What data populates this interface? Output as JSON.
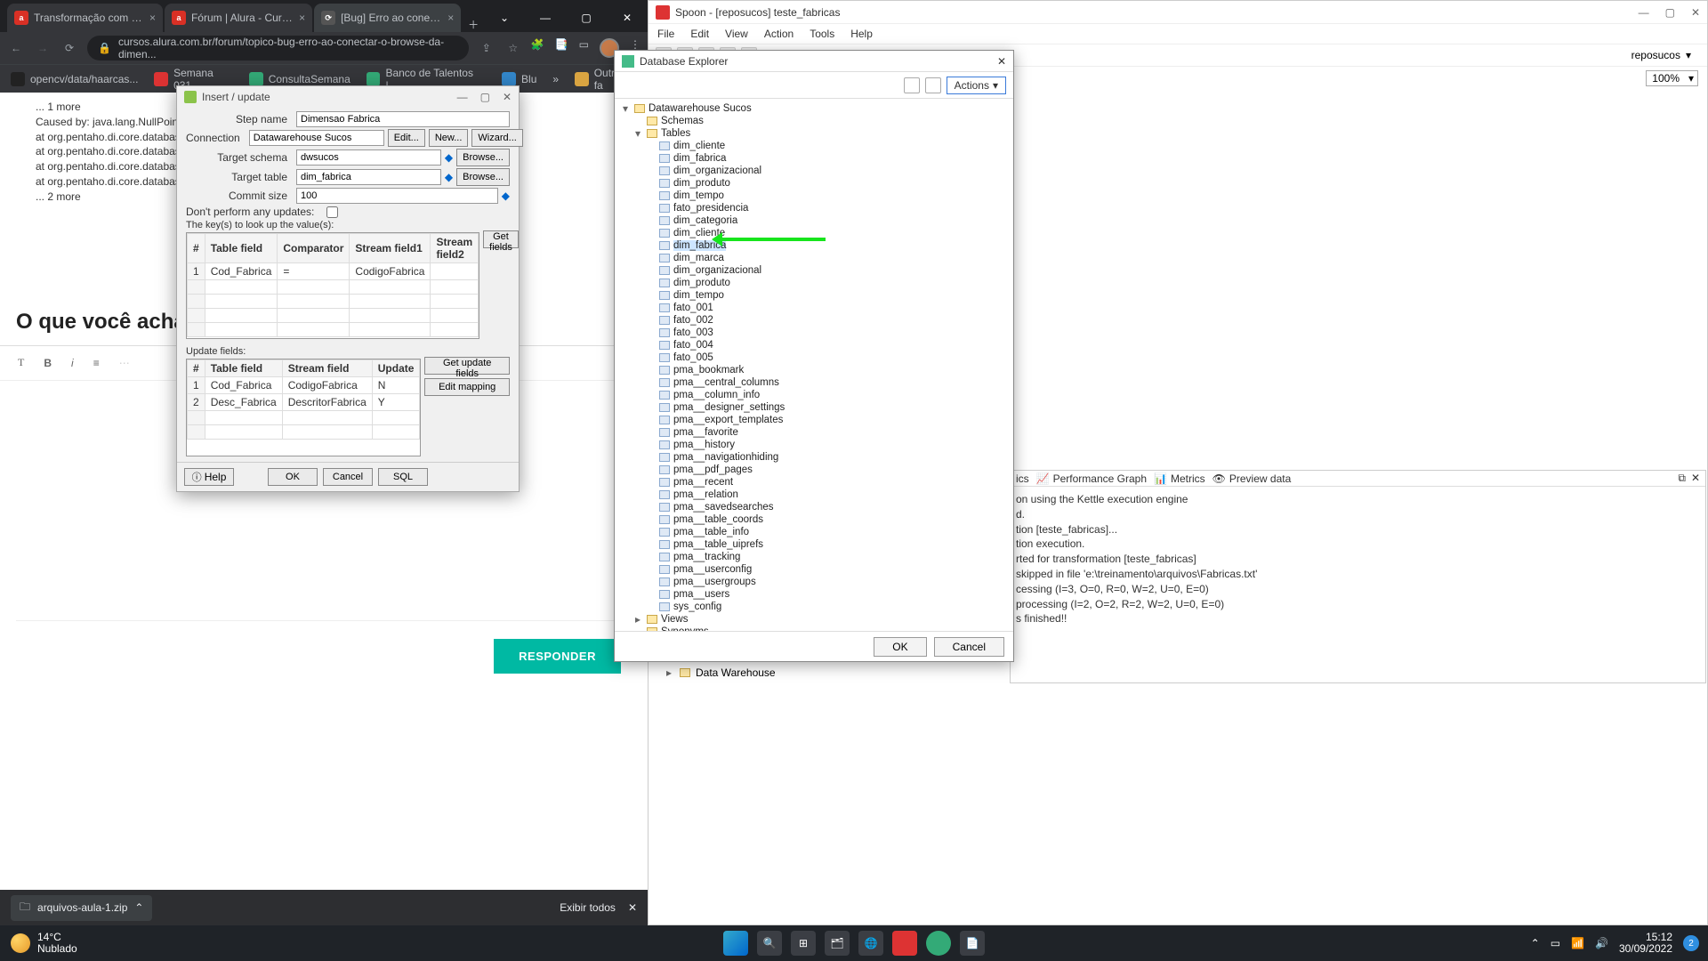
{
  "browser": {
    "tabs": [
      {
        "label": "Transformação com ETL: Pe"
      },
      {
        "label": "Fórum | Alura - Cursos onli"
      },
      {
        "label": "[Bug] Erro ao conectar o B"
      }
    ],
    "url": "cursos.alura.com.br/forum/topico-bug-erro-ao-conectar-o-browse-da-dimen...",
    "bookmarks": [
      "opencv/data/haarcas...",
      "Semana 031",
      "ConsultaSemana",
      "Banco de Talentos |...",
      "Blu"
    ],
    "bookmarks_right": "Outros fa",
    "error_lines": [
      "... 1 more",
      "Caused by: java.lang.NullPointerException",
      "    at org.pentaho.di.core.database.Datab",
      "    at org.pentaho.di.core.database.Datab",
      "    at org.pentaho.di.core.database.Datab",
      "    at org.pentaho.di.core.database.Datab",
      "    ... 2 more"
    ],
    "heading": "O que você acha disso?",
    "respond": "RESPONDER",
    "download": "arquivos-aula-1.zip",
    "show_all": "Exibir todos"
  },
  "iu": {
    "title": "Insert / update",
    "labels": {
      "step": "Step name",
      "conn": "Connection",
      "schema": "Target schema",
      "table": "Target table",
      "commit": "Commit size",
      "dont": "Don't perform any updates:",
      "keys": "The key(s) to look up the value(s):",
      "update": "Update fields:"
    },
    "vals": {
      "step": "Dimensao Fabrica",
      "conn": "Datawarehouse Sucos",
      "schema": "dwsucos",
      "table": "dim_fabrica",
      "commit": "100"
    },
    "btns": {
      "edit": "Edit...",
      "new": "New...",
      "wiz": "Wizard...",
      "browse": "Browse...",
      "getf": "Get fields",
      "getuf": "Get update fields",
      "editmap": "Edit mapping",
      "ok": "OK",
      "cancel": "Cancel",
      "sql": "SQL",
      "help": "Help"
    },
    "keycols": [
      "#",
      "Table field",
      "Comparator",
      "Stream field1",
      "Stream field2"
    ],
    "keyrow": {
      "n": "1",
      "tf": "Cod_Fabrica",
      "cmp": "=",
      "s1": "CodigoFabrica",
      "s2": ""
    },
    "updcols": [
      "#",
      "Table field",
      "Stream field",
      "Update"
    ],
    "updrows": [
      {
        "n": "1",
        "tf": "Cod_Fabrica",
        "sf": "CodigoFabrica",
        "u": "N"
      },
      {
        "n": "2",
        "tf": "Desc_Fabrica",
        "sf": "DescritorFabrica",
        "u": "Y"
      }
    ]
  },
  "spoon": {
    "title": "Spoon - [reposucos] teste_fabricas",
    "menu": [
      "File",
      "Edit",
      "View",
      "Action",
      "Tools",
      "Help"
    ],
    "persp": "reposucos",
    "zoom": "100%"
  },
  "dbex": {
    "title": "Database Explorer",
    "actions": "Actions",
    "root": "Datawarehouse Sucos",
    "schemas": "Schemas",
    "tables": "Tables",
    "tablelist": [
      "dim_cliente",
      "dim_fabrica",
      "dim_organizacional",
      "dim_produto",
      "dim_tempo",
      "fato_presidencia",
      "dim_categoria",
      "dim_cliente",
      "dim_fabrica",
      "dim_marca",
      "dim_organizacional",
      "dim_produto",
      "dim_tempo",
      "fato_001",
      "fato_002",
      "fato_003",
      "fato_004",
      "fato_005",
      "pma_bookmark",
      "pma__central_columns",
      "pma__column_info",
      "pma__designer_settings",
      "pma__export_templates",
      "pma__favorite",
      "pma__history",
      "pma__navigationhiding",
      "pma__pdf_pages",
      "pma__recent",
      "pma__relation",
      "pma__savedsearches",
      "pma__table_coords",
      "pma__table_info",
      "pma__table_uiprefs",
      "pma__tracking",
      "pma__userconfig",
      "pma__usergroups",
      "pma__users",
      "sys_config"
    ],
    "highlight_index": 8,
    "views": "Views",
    "synonyms": "Synonyms",
    "ok": "OK",
    "cancel": "Cancel"
  },
  "log": {
    "tabs": [
      "ics",
      "Performance Graph",
      "Metrics",
      "Preview data"
    ],
    "lines": [
      "on using the Kettle execution engine",
      "d.",
      "tion [teste_fabricas]...",
      "tion execution.",
      "rted for transformation [teste_fabricas]",
      "skipped in file 'e:\\treinamento\\arquivos\\Fabricas.txt'",
      "cessing (I=3, O=0, R=0, W=2, U=0, E=0)",
      "processing (I=2, O=2, R=2, W=2, U=0, E=0)",
      "s finished!!"
    ]
  },
  "tree_peek": "Data Warehouse",
  "taskbar": {
    "temp": "14°C",
    "cond": "Nublado",
    "time": "15:12",
    "date": "30/09/2022",
    "notif": "2"
  }
}
